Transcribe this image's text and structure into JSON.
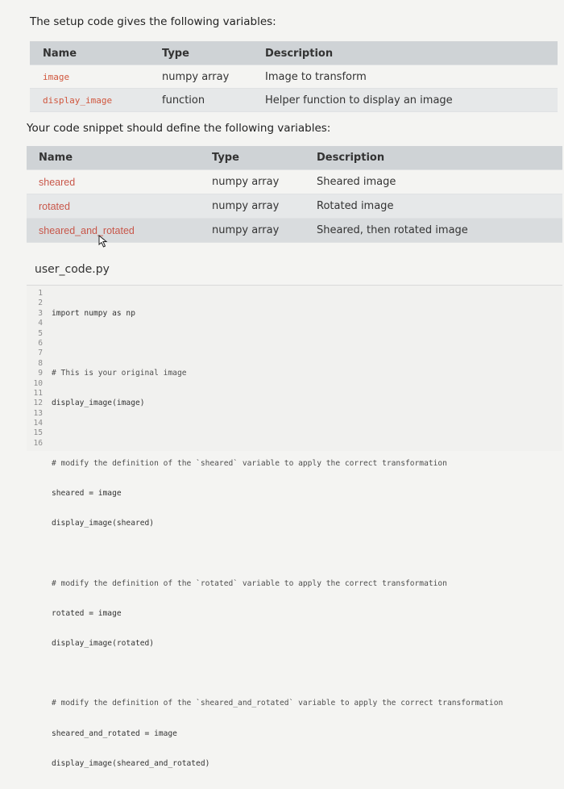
{
  "intro": "The setup code gives the following variables:",
  "setup_table": {
    "headers": [
      "Name",
      "Type",
      "Description"
    ],
    "rows": [
      {
        "name": "image",
        "type": "numpy array",
        "description": "Image to transform"
      },
      {
        "name": "display_image",
        "type": "function",
        "description": "Helper function to display an image"
      }
    ]
  },
  "define_intro": "Your code snippet should define the following variables:",
  "define_table": {
    "headers": [
      "Name",
      "Type",
      "Description"
    ],
    "rows": [
      {
        "name": "sheared",
        "type": "numpy array",
        "description": "Sheared image"
      },
      {
        "name": "rotated",
        "type": "numpy array",
        "description": "Rotated image"
      },
      {
        "name": "sheared_and_rotated",
        "type": "numpy array",
        "description": "Sheared, then rotated image"
      }
    ]
  },
  "editor": {
    "filename": "user_code.py",
    "line_numbers": [
      "1",
      "2",
      "3",
      "4",
      "5",
      "6",
      "7",
      "8",
      "9",
      "10",
      "11",
      "12",
      "13",
      "14",
      "15",
      "16"
    ],
    "lines": [
      "import numpy as np",
      "",
      "# This is your original image",
      "display_image(image)",
      "",
      "# modify the definition of the `sheared` variable to apply the correct transformation",
      "sheared = image",
      "display_image(sheared)",
      "",
      "# modify the definition of the `rotated` variable to apply the correct transformation",
      "rotated = image",
      "display_image(rotated)",
      "",
      "# modify the definition of the `sheared_and_rotated` variable to apply the correct transformation",
      "sheared_and_rotated = image",
      "display_image(sheared_and_rotated)"
    ]
  },
  "icons": {
    "cursor": "mouse-pointer-icon"
  }
}
